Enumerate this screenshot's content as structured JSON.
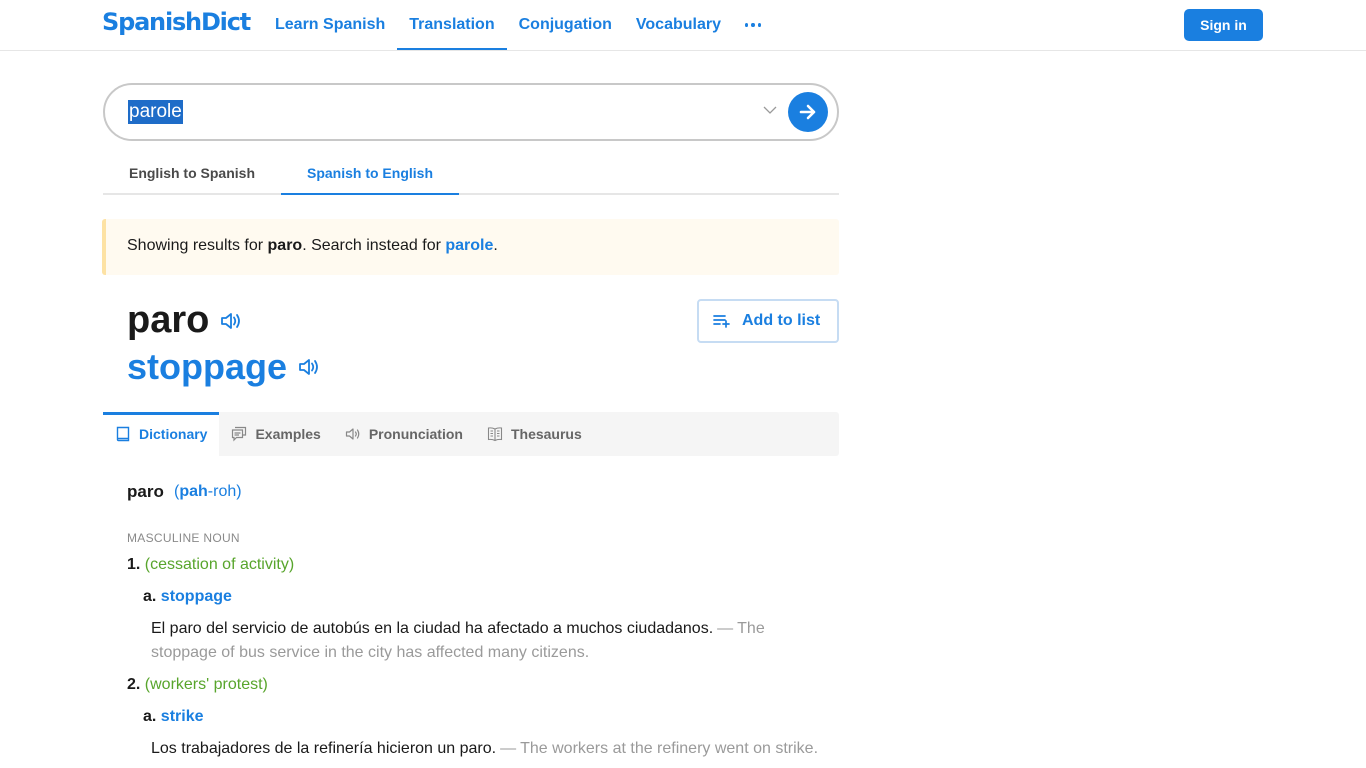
{
  "header": {
    "logo": "SpanishDict",
    "nav": [
      {
        "label": "Learn Spanish",
        "active": false
      },
      {
        "label": "Translation",
        "active": true
      },
      {
        "label": "Conjugation",
        "active": false
      },
      {
        "label": "Vocabulary",
        "active": false
      }
    ],
    "more_icon": "ellipsis-icon",
    "signin_label": "Sign in"
  },
  "search": {
    "value": "parole",
    "dropdown_icon": "chevron-down-icon",
    "submit_icon": "arrow-right-icon"
  },
  "direction_tabs": [
    {
      "label": "English to Spanish",
      "active": false
    },
    {
      "label": "Spanish to English",
      "active": true
    }
  ],
  "notice": {
    "prefix": "Showing results for ",
    "result_word": "paro",
    "middle": ". Search instead for ",
    "original_word": "parole",
    "suffix": "."
  },
  "headword": {
    "word": "paro",
    "translation": "stoppage",
    "add_to_list_label": "Add to list"
  },
  "section_tabs": [
    {
      "label": "Dictionary",
      "icon": "book-icon",
      "active": true
    },
    {
      "label": "Examples",
      "icon": "speech-bubbles-icon",
      "active": false
    },
    {
      "label": "Pronunciation",
      "icon": "speaker-icon",
      "active": false
    },
    {
      "label": "Thesaurus",
      "icon": "open-book-icon",
      "active": false
    }
  ],
  "entry": {
    "word": "paro",
    "pron_open": "(",
    "pron_stressed": "pah",
    "pron_rest": "-roh)",
    "part_of_speech": "MASCULINE NOUN",
    "senses": [
      {
        "number": "1.",
        "context": "(cessation of activity)",
        "sub_letter": "a.",
        "translation": "stoppage",
        "example_es": "El paro del servicio de autobús en la ciudad ha afectado a muchos ciudadanos.",
        "example_en": "The stoppage of bus service in the city has affected many citizens."
      },
      {
        "number": "2.",
        "context": "(workers' protest)",
        "sub_letter": "a.",
        "translation": "strike",
        "example_es": "Los trabajadores de la refinería hicieron un paro.",
        "example_en": "The workers at the refinery went on strike."
      }
    ],
    "dash": "—"
  },
  "colors": {
    "brand": "#1a7fe0",
    "context_green": "#58a52c",
    "notice_bg": "#fffaf0",
    "notice_border": "#fde2a4"
  }
}
